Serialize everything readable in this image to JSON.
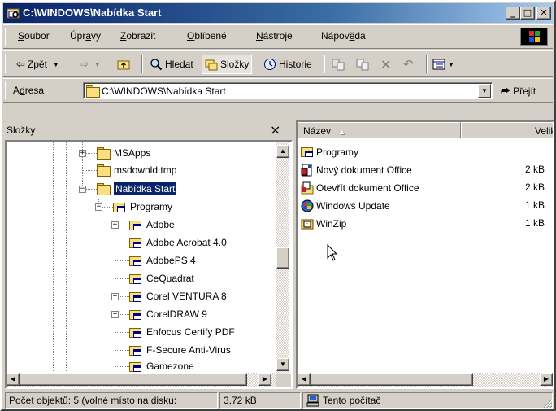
{
  "window": {
    "title": "C:\\WINDOWS\\Nabídka Start",
    "minimize": "_",
    "maximize": "□",
    "close": "✕"
  },
  "menu": [
    {
      "pre": "",
      "u": "S",
      "post": "oubor"
    },
    {
      "pre": "Úpr",
      "u": "a",
      "post": "vy"
    },
    {
      "pre": "",
      "u": "Z",
      "post": "obrazit"
    },
    {
      "pre": "",
      "u": "O",
      "post": "blíbené"
    },
    {
      "pre": "",
      "u": "N",
      "post": "ástroje"
    },
    {
      "pre": "Nápov",
      "u": "ě",
      "post": "da"
    }
  ],
  "toolbar": {
    "back": "Zpět",
    "search": "Hledat",
    "folders": "Složky",
    "history": "Historie"
  },
  "address": {
    "label_pre": "A",
    "label_u": "d",
    "label_post": "resa",
    "value": "C:\\WINDOWS\\Nabídka Start",
    "go": "Přejít"
  },
  "folders_pane": {
    "title": "Složky",
    "close": "×",
    "items": [
      {
        "label": "MSApps"
      },
      {
        "label": "msdownld.tmp"
      },
      {
        "label": "Nabídka Start"
      },
      {
        "label": "Programy"
      },
      {
        "label": "Adobe"
      },
      {
        "label": "Adobe Acrobat 4.0"
      },
      {
        "label": "AdobePS 4"
      },
      {
        "label": "CeQuadrat"
      },
      {
        "label": "Corel VENTURA 8"
      },
      {
        "label": "CorelDRAW 9"
      },
      {
        "label": "Enfocus Certify PDF"
      },
      {
        "label": "F-Secure Anti-Virus"
      },
      {
        "label": "Gamezone"
      }
    ]
  },
  "file_list": {
    "columns": {
      "name": "Název",
      "size": "Velikos"
    },
    "rows": [
      {
        "name": "Programy",
        "size": ""
      },
      {
        "name": "Nový dokument Office",
        "size": "2 kB"
      },
      {
        "name": "Otevřít dokument Office",
        "size": "2 kB"
      },
      {
        "name": "Windows Update",
        "size": "1 kB"
      },
      {
        "name": "WinZip",
        "size": "1 kB"
      }
    ]
  },
  "status": {
    "objects": "Počet objektů: 5 (volné místo na disku:",
    "size": "3,72 kB",
    "location": "Tento počítač"
  },
  "colors": {
    "title_active": "#0a246a",
    "selection": "#0a246a",
    "face": "#d4d0c8"
  }
}
